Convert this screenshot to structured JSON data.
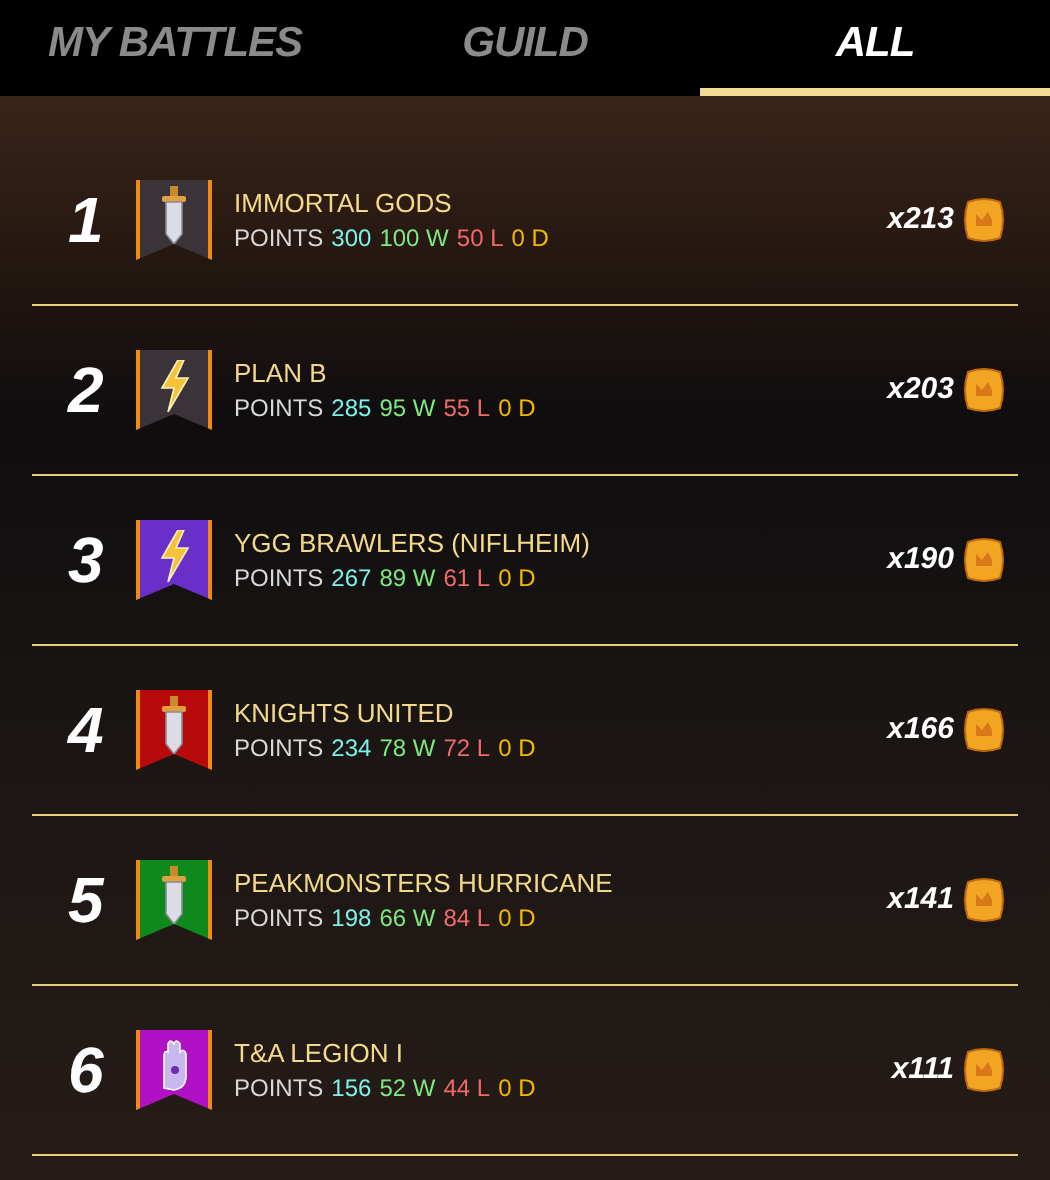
{
  "tabs": [
    {
      "label": "MY BATTLES",
      "selected": false
    },
    {
      "label": "GUILD",
      "selected": false
    },
    {
      "label": "ALL",
      "selected": true
    }
  ],
  "rows": [
    {
      "rank": "1",
      "name": "IMMORTAL GODS",
      "points_label": "POINTS",
      "points": "300",
      "wins": "100 W",
      "losses": "50 L",
      "draws": "0 D",
      "reward": "x213",
      "color": "#3a3438",
      "kind": "sword"
    },
    {
      "rank": "2",
      "name": "PLAN B",
      "points_label": "POINTS",
      "points": "285",
      "wins": "95 W",
      "losses": "55 L",
      "draws": "0 D",
      "reward": "x203",
      "color": "#3a3438",
      "kind": "bolt"
    },
    {
      "rank": "3",
      "name": "YGG BRAWLERS (NIFLHEIM)",
      "points_label": "POINTS",
      "points": "267",
      "wins": "89 W",
      "losses": "61 L",
      "draws": "0 D",
      "reward": "x190",
      "color": "#6a2fc8",
      "kind": "bolt"
    },
    {
      "rank": "4",
      "name": "KNIGHTS UNITED",
      "points_label": "POINTS",
      "points": "234",
      "wins": "78 W",
      "losses": "72 L",
      "draws": "0 D",
      "reward": "x166",
      "color": "#b80a0a",
      "kind": "sword"
    },
    {
      "rank": "5",
      "name": "PEAKMONSTERS HURRICANE",
      "points_label": "POINTS",
      "points": "198",
      "wins": "66 W",
      "losses": "84 L",
      "draws": "0 D",
      "reward": "x141",
      "color": "#0e8a1c",
      "kind": "sword"
    },
    {
      "rank": "6",
      "name": "T&A LEGION I",
      "points_label": "POINTS",
      "points": "156",
      "wins": "52 W",
      "losses": "44 L",
      "draws": "0 D",
      "reward": "x111",
      "color": "#b011c4",
      "kind": "hand"
    }
  ]
}
